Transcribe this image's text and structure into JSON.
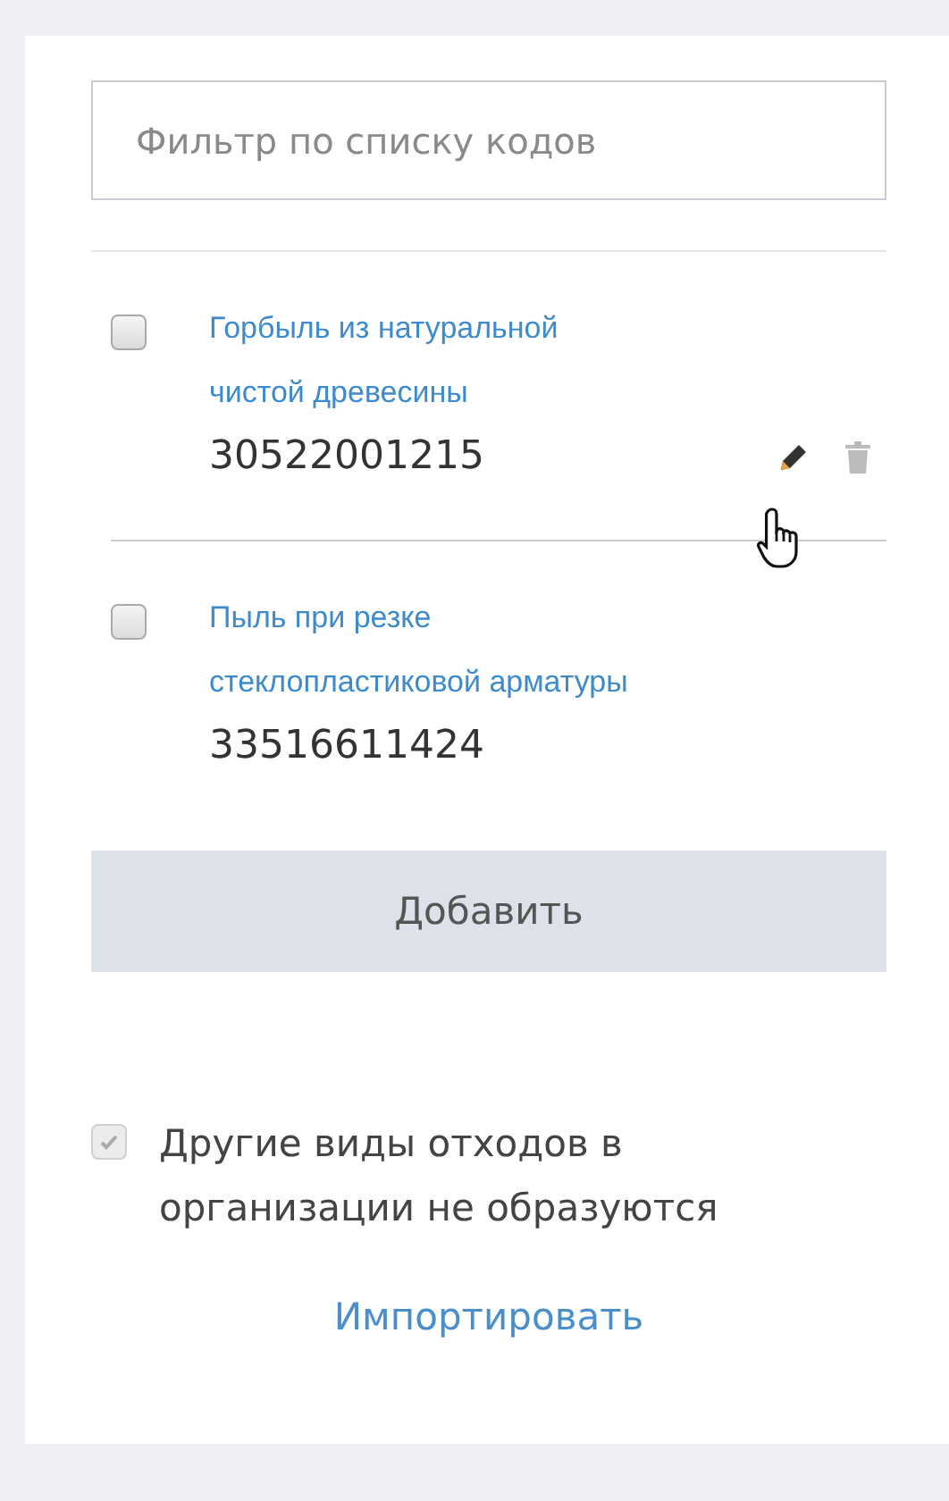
{
  "filter": {
    "placeholder": "Фильтр по списку кодов"
  },
  "items": [
    {
      "name": "Горбыль из натуральной чистой древесины",
      "code": "30522001215",
      "checked": false,
      "actions_shown": true
    },
    {
      "name": "Пыль при резке стеклопластиковой арматуры",
      "code": "33516611424",
      "checked": false,
      "actions_shown": false
    }
  ],
  "add_button": "Добавить",
  "no_other_waste": {
    "label": "Другие виды отходов в организации не образуются",
    "checked": true,
    "disabled": true
  },
  "import_link": "Импортировать"
}
